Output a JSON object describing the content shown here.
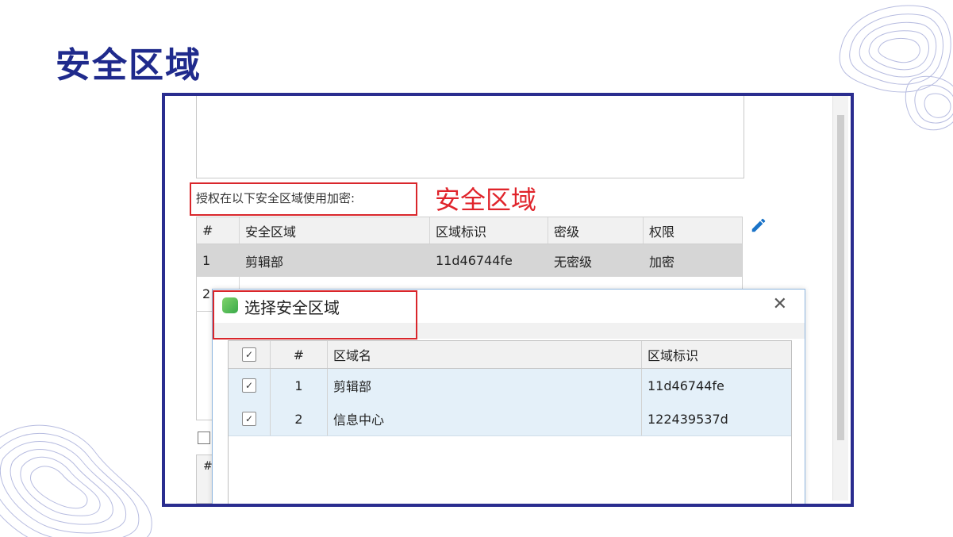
{
  "slide": {
    "title": "安全区域"
  },
  "main": {
    "auth_label": "授权在以下安全区域使用加密:",
    "annotation": "安全区域",
    "table": {
      "headers": [
        "#",
        "安全区域",
        "区域标识",
        "密级",
        "权限"
      ],
      "rows": [
        [
          "1",
          "剪辑部",
          "11d46744fe",
          "无密级",
          "加密"
        ],
        [
          "2",
          "",
          "",
          "",
          ""
        ]
      ]
    },
    "bottom_table_header": "#",
    "edit_icon": "pencil-icon"
  },
  "dialog": {
    "title": "选择安全区域",
    "close_icon": "close-icon",
    "headers": [
      "#",
      "区域名",
      "区域标识"
    ],
    "rows": [
      {
        "checked": true,
        "num": "1",
        "name": "剪辑部",
        "id": "11d46744fe"
      },
      {
        "checked": true,
        "num": "2",
        "name": "信息中心",
        "id": "122439537d"
      }
    ]
  },
  "colors": {
    "title": "#1f2a8c",
    "frame": "#2a2d8f",
    "annotation_red": "#d9262b",
    "selected_row": "#e4f0f9",
    "edit_icon": "#1a73c8"
  }
}
